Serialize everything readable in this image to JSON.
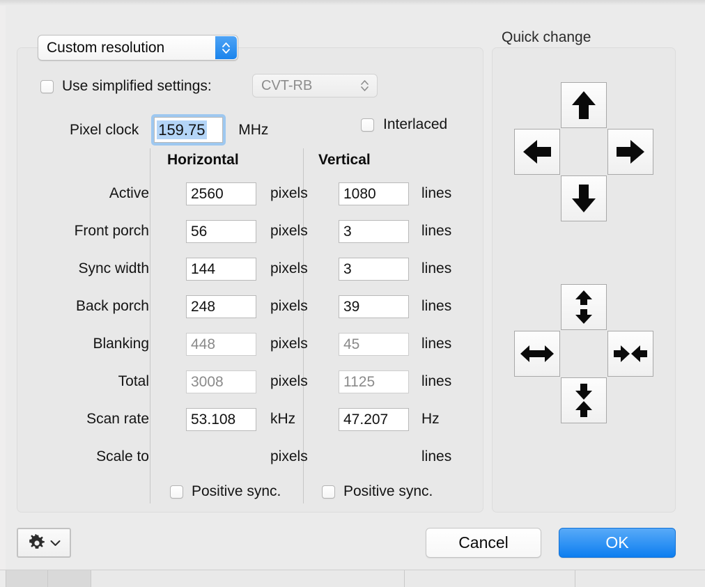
{
  "dialog": {
    "resolution_popup": {
      "value": "Custom resolution"
    },
    "simplified": {
      "label": "Use simplified settings:",
      "checked": false,
      "timing_standard": "CVT-RB"
    },
    "pixel_clock": {
      "label": "Pixel clock",
      "value": "159.75",
      "unit": "MHz",
      "focused": true,
      "selected": true
    },
    "interlaced": {
      "label": "Interlaced",
      "checked": false
    }
  },
  "timing_table": {
    "columns": [
      "Horizontal",
      "Vertical"
    ],
    "units": {
      "horizontal": "pixels",
      "vertical": "lines"
    },
    "rows": [
      {
        "label": "Active",
        "h": "2560",
        "v": "1080",
        "h_unit": "pixels",
        "v_unit": "lines",
        "readonly": false
      },
      {
        "label": "Front porch",
        "h": "56",
        "v": "3",
        "h_unit": "pixels",
        "v_unit": "lines",
        "readonly": false
      },
      {
        "label": "Sync width",
        "h": "144",
        "v": "3",
        "h_unit": "pixels",
        "v_unit": "lines",
        "readonly": false
      },
      {
        "label": "Back porch",
        "h": "248",
        "v": "39",
        "h_unit": "pixels",
        "v_unit": "lines",
        "readonly": false
      },
      {
        "label": "Blanking",
        "h": "448",
        "v": "45",
        "h_unit": "pixels",
        "v_unit": "lines",
        "readonly": true
      },
      {
        "label": "Total",
        "h": "3008",
        "v": "1125",
        "h_unit": "pixels",
        "v_unit": "lines",
        "readonly": true
      },
      {
        "label": "Scan rate",
        "h": "53.108",
        "v": "47.207",
        "h_unit": "kHz",
        "v_unit": "Hz",
        "readonly": false
      },
      {
        "label": "Scale to",
        "h": "",
        "v": "",
        "h_unit": "pixels",
        "v_unit": "lines",
        "readonly": false,
        "no_fields": true
      }
    ],
    "positive_sync_horizontal": {
      "label": "Positive sync.",
      "checked": false
    },
    "positive_sync_vertical": {
      "label": "Positive sync.",
      "checked": false
    }
  },
  "quick_change": {
    "title": "Quick change",
    "move_pad": {
      "up": "move-up",
      "left": "move-left",
      "right": "move-right",
      "down": "move-down"
    },
    "size_pad": {
      "up": "expand-vertical",
      "left": "expand-horizontal",
      "right": "shrink-horizontal",
      "down": "shrink-vertical"
    }
  },
  "footer": {
    "gear_menu": "settings-menu",
    "cancel_label": "Cancel",
    "ok_label": "OK"
  },
  "colors": {
    "accent_blue": "#1a84ec",
    "ok_blue_top": "#58aaf8",
    "ok_blue_bottom": "#0d7ef0",
    "selection_blue": "#b4d5f7",
    "focus_ring": "#9ec8f0",
    "window_bg": "#ebebeb",
    "group_bg": "#e8e8e8",
    "disabled_text": "#8a8a8a"
  }
}
